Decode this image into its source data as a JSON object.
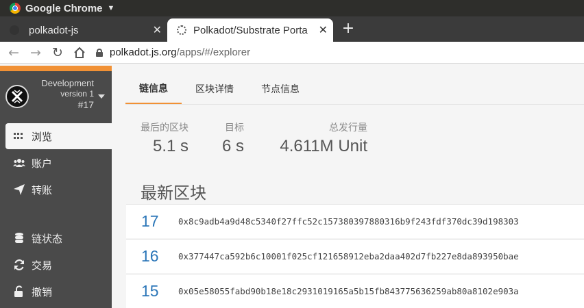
{
  "os_bar": {
    "app_name": "Google Chrome"
  },
  "browser": {
    "tabs": [
      {
        "title": "polkadot-js"
      },
      {
        "title": "Polkadot/Substrate Porta"
      }
    ],
    "url": {
      "host": "polkadot.js.org",
      "path": "/apps/#/explorer"
    }
  },
  "sidebar": {
    "chain": {
      "name": "Development",
      "version": "version 1",
      "block": "#17"
    },
    "items": [
      {
        "label": "浏览",
        "icon": "grid-dots-icon",
        "active": true
      },
      {
        "label": "账户",
        "icon": "users-icon"
      },
      {
        "label": "转账",
        "icon": "paper-plane-icon"
      },
      {
        "label": "链状态",
        "icon": "database-icon"
      },
      {
        "label": "交易",
        "icon": "sync-icon"
      },
      {
        "label": "撤销",
        "icon": "unlock-icon"
      }
    ]
  },
  "main": {
    "tabs": [
      {
        "label": "链信息",
        "active": true
      },
      {
        "label": "区块详情"
      },
      {
        "label": "节点信息"
      }
    ],
    "stats": [
      {
        "label": "最后的区块",
        "value": "5.1 s"
      },
      {
        "label": "目标",
        "value": "6 s"
      },
      {
        "label": "总发行量",
        "value": "4.611M Unit"
      }
    ],
    "recent_title": "最新区块",
    "blocks": [
      {
        "number": "17",
        "hash": "0x8c9adb4a9d48c5340f27ffc52c157380397880316b9f243fdf370dc39d198303"
      },
      {
        "number": "16",
        "hash": "0x377447ca592b6c10001f025cf121658912eba2daa402d7fb227e8da893950bae"
      },
      {
        "number": "15",
        "hash": "0x05e58055fabd90b18e18c2931019165a5b15fb843775636259ab80a8102e903a"
      }
    ]
  },
  "colors": {
    "accent": "#f19135",
    "sidebar": "#4a4a4a",
    "link": "#2b76b8"
  }
}
